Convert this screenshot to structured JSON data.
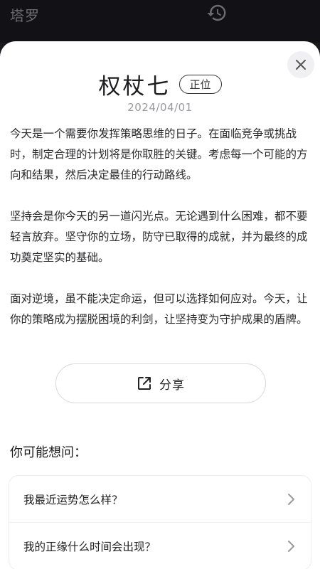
{
  "app": {
    "title": "塔罗"
  },
  "card": {
    "name": "权杖七",
    "orientation": "正位",
    "date": "2024/04/01"
  },
  "reading": {
    "paragraphs": [
      "今天是一个需要你发挥策略思维的日子。在面临竞争或挑战时，制定合理的计划将是你取胜的关键。考虑每一个可能的方向和结果，然后决定最佳的行动路线。",
      "坚持会是你今天的另一道闪光点。无论遇到什么困难，都不要轻言放弃。坚守你的立场，防守已取得的成就，并为最终的成功奠定坚实的基础。",
      "面对逆境，虽不能决定命运，但可以选择如何应对。今天，让你的策略成为摆脱困境的利剑，让坚持变为守护成果的盾牌。"
    ]
  },
  "share": {
    "label": "分享"
  },
  "faq": {
    "title": "你可能想问：",
    "items": [
      {
        "label": "我最近运势怎么样？"
      },
      {
        "label": "我的正缘什么时间会出现？"
      }
    ]
  },
  "icons": {
    "history": "history-icon",
    "close": "close-icon",
    "share": "share-icon",
    "chevron": "chevron-right-icon"
  }
}
